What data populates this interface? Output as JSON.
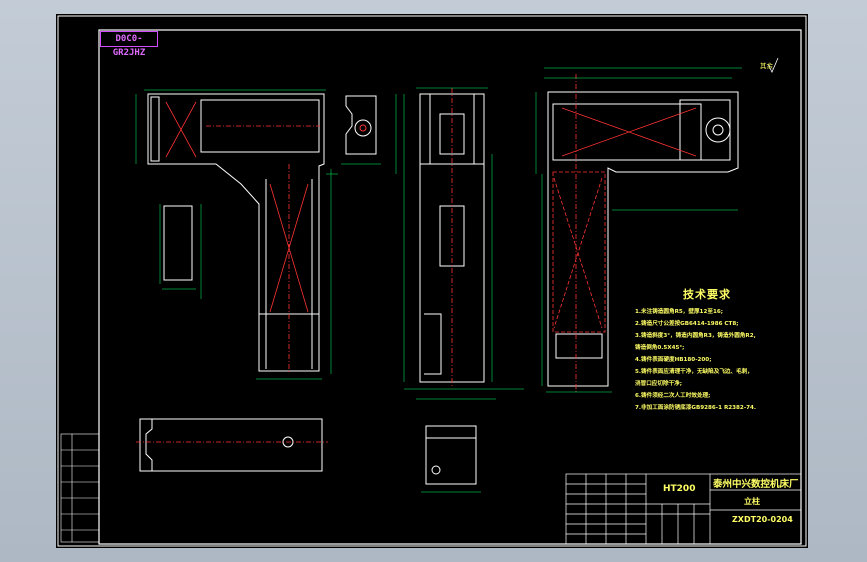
{
  "drawing": {
    "tag": "D0C0-GR2JHZ",
    "roughness_note": "其余",
    "material": "HT200",
    "company": "泰州中兴数控机床厂",
    "part_name": "立柱",
    "drawing_number": "ZXDT20-0204"
  },
  "technical_requirements": {
    "title": "技术要求",
    "items": [
      "1.未注铸造圆角R5，壁厚12至16;",
      "2.铸造尺寸公差按GB6414-1986 CT8;",
      "3.铸造斜度3°，铸造内圆角R3，铸造外圆角R2,",
      "铸造倒角0.5X45°;",
      "4.铸件表面硬度HB180-200;",
      "5.铸件表面应清理干净，无缺陷及飞边、毛刺，",
      "浇冒口应切除干净;",
      "6.铸件须经二次人工时效处理;",
      "7.非加工面涂防锈底漆GB9286-1 R2382-74."
    ]
  },
  "colors": {
    "background": "#000000",
    "outline": "#ffffff",
    "dimension": "#00ff66",
    "centerline": "#ff3333",
    "note": "#ffff66",
    "frame": "#d34cff"
  }
}
